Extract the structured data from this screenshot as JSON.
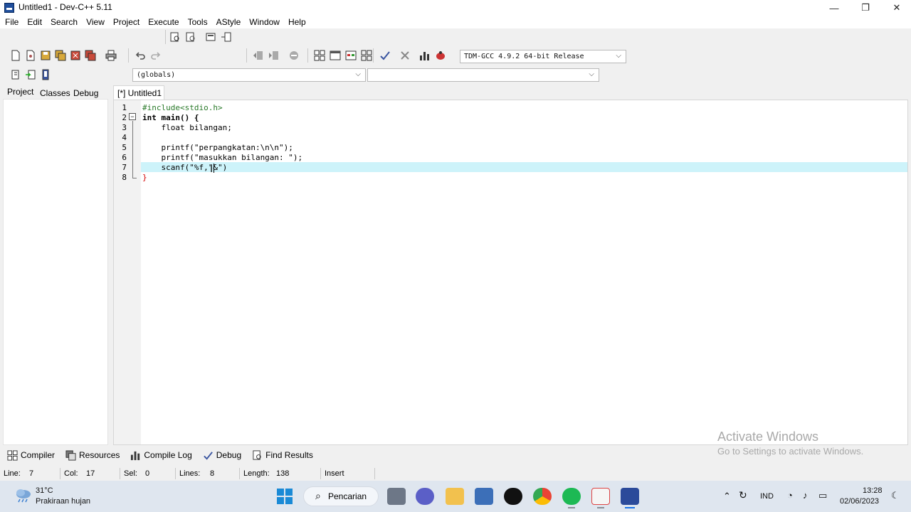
{
  "window": {
    "title": "Untitled1 - Dev-C++ 5.11",
    "controls": [
      "minimize-icon",
      "restore-icon",
      "close-icon"
    ]
  },
  "menu": [
    "File",
    "Edit",
    "Search",
    "View",
    "Project",
    "Execute",
    "Tools",
    "AStyle",
    "Window",
    "Help"
  ],
  "toolbar": {
    "compiler_select": "TDM-GCC 4.9.2 64-bit Release",
    "scope_select": "(globals)",
    "member_select": ""
  },
  "left_panel": {
    "tabs": [
      "Project",
      "Classes",
      "Debug"
    ],
    "active_tab": "Project"
  },
  "editor": {
    "tab_label": "[*] Untitled1",
    "current_line": 7,
    "lines": [
      {
        "num": "1",
        "text": "#include<stdio.h>"
      },
      {
        "num": "2",
        "text": "int main() {"
      },
      {
        "num": "3",
        "text": "    float bilangan;"
      },
      {
        "num": "4",
        "text": ""
      },
      {
        "num": "5",
        "text": "    printf(\"perpangkatan:\\n\\n\");"
      },
      {
        "num": "6",
        "text": "    printf(\"masukkan bilangan: \");"
      },
      {
        "num": "7",
        "text": "    scanf(\"%f,\"&\")"
      },
      {
        "num": "8",
        "text": "}"
      }
    ]
  },
  "bottom_tabs": [
    {
      "label": "Compiler",
      "icon": "grid-icon"
    },
    {
      "label": "Resources",
      "icon": "resources-icon"
    },
    {
      "label": "Compile Log",
      "icon": "chart-icon"
    },
    {
      "label": "Debug",
      "icon": "check-icon"
    },
    {
      "label": "Find Results",
      "icon": "find-icon"
    }
  ],
  "status": {
    "line_label": "Line:",
    "line_value": "7",
    "col_label": "Col:",
    "col_value": "17",
    "sel_label": "Sel:",
    "sel_value": "0",
    "lines_label": "Lines:",
    "lines_value": "8",
    "length_label": "Length:",
    "length_value": "138",
    "mode": "Insert"
  },
  "watermark": {
    "line1": "Activate Windows",
    "line2": "Go to Settings to activate Windows."
  },
  "taskbar": {
    "weather_temp": "31°C",
    "weather_desc": "Prakiraan hujan",
    "search_label": "Pencarian",
    "language": "IND",
    "time": "13:28",
    "date": "02/06/2023"
  },
  "colors": {
    "current_line": "#cdf3fa",
    "string": "#1b2fb5",
    "preprocessor": "#2a7a2a",
    "brace": "#d40000",
    "taskbar": "#dfe6ef"
  }
}
